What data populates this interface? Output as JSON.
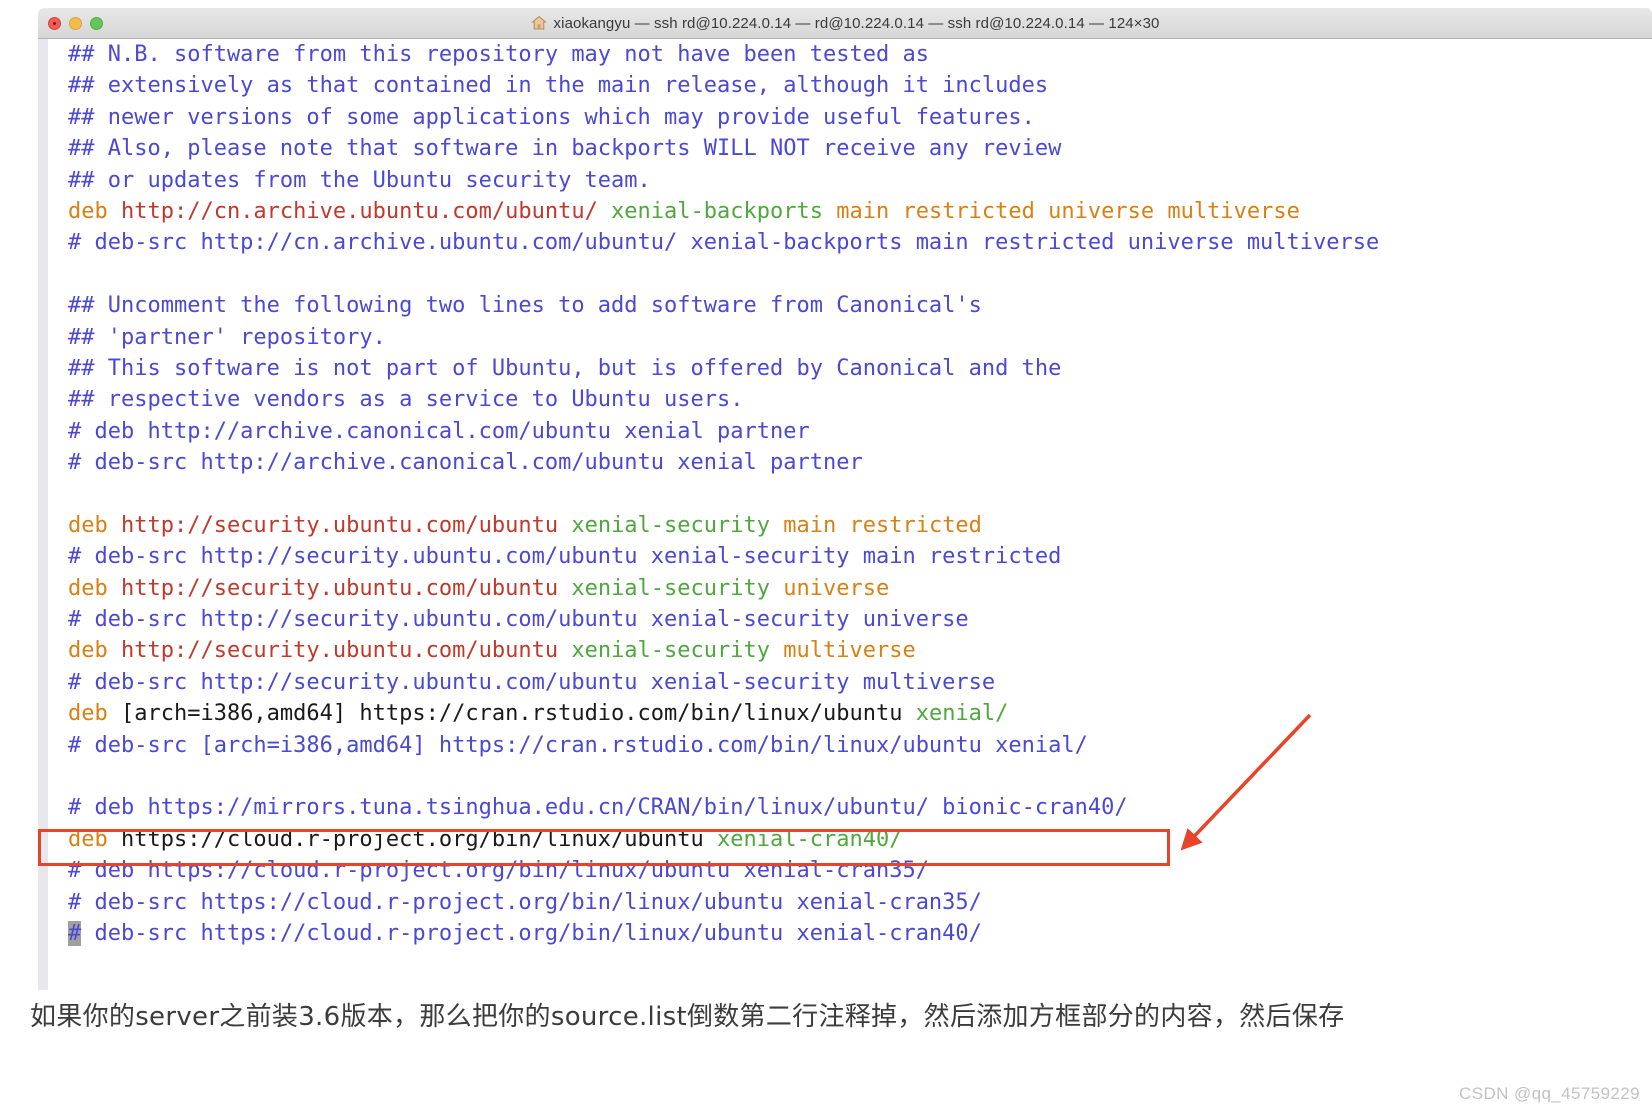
{
  "window": {
    "title": "xiaokangyu — ssh rd@10.224.0.14 — rd@10.224.0.14 — ssh rd@10.224.0.14 — 124×30",
    "home_icon": "home-icon",
    "controls": {
      "close": "close-button",
      "minimize": "minimize-button",
      "zoom": "zoom-button"
    }
  },
  "colors": {
    "comment": "#4b49d4",
    "deb_keyword": "#d98014",
    "url": "#c0392b",
    "distribution": "#4fa83d",
    "components": "#d98014",
    "plain": "#1a1a1a",
    "annotation": "#e8442a",
    "cursor": "#a0a0a0"
  },
  "terminal": {
    "lines": [
      {
        "id": 1,
        "segments": [
          {
            "text": "## N.B. software from this repository may not have been tested as",
            "style": "comment"
          }
        ]
      },
      {
        "id": 2,
        "segments": [
          {
            "text": "## extensively as that contained in the main release, although it includes",
            "style": "comment"
          }
        ]
      },
      {
        "id": 3,
        "segments": [
          {
            "text": "## newer versions of some applications which may provide useful features.",
            "style": "comment"
          }
        ]
      },
      {
        "id": 4,
        "segments": [
          {
            "text": "## Also, please note that software in backports WILL NOT receive any review",
            "style": "comment"
          }
        ]
      },
      {
        "id": 5,
        "segments": [
          {
            "text": "## or updates from the Ubuntu security team.",
            "style": "comment"
          }
        ]
      },
      {
        "id": 6,
        "segments": [
          {
            "text": "deb ",
            "style": "deb"
          },
          {
            "text": "http://cn.archive.ubuntu.com/ubuntu/ ",
            "style": "url"
          },
          {
            "text": "xenial-backports ",
            "style": "dist"
          },
          {
            "text": "main restricted universe multiverse",
            "style": "comp"
          }
        ]
      },
      {
        "id": 7,
        "segments": [
          {
            "text": "# deb-src http://cn.archive.ubuntu.com/ubuntu/ xenial-backports main restricted universe multiverse",
            "style": "comment"
          }
        ]
      },
      {
        "id": 8,
        "segments": [
          {
            "text": "",
            "style": "plain"
          }
        ]
      },
      {
        "id": 9,
        "segments": [
          {
            "text": "## Uncomment the following two lines to add software from Canonical's",
            "style": "comment"
          }
        ]
      },
      {
        "id": 10,
        "segments": [
          {
            "text": "## 'partner' repository.",
            "style": "comment"
          }
        ]
      },
      {
        "id": 11,
        "segments": [
          {
            "text": "## This software is not part of Ubuntu, but is offered by Canonical and the",
            "style": "comment"
          }
        ]
      },
      {
        "id": 12,
        "segments": [
          {
            "text": "## respective vendors as a service to Ubuntu users.",
            "style": "comment"
          }
        ]
      },
      {
        "id": 13,
        "segments": [
          {
            "text": "# deb http://archive.canonical.com/ubuntu xenial partner",
            "style": "comment"
          }
        ]
      },
      {
        "id": 14,
        "segments": [
          {
            "text": "# deb-src http://archive.canonical.com/ubuntu xenial partner",
            "style": "comment"
          }
        ]
      },
      {
        "id": 15,
        "segments": [
          {
            "text": "",
            "style": "plain"
          }
        ]
      },
      {
        "id": 16,
        "segments": [
          {
            "text": "deb ",
            "style": "deb"
          },
          {
            "text": "http://security.ubuntu.com/ubuntu ",
            "style": "url"
          },
          {
            "text": "xenial-security ",
            "style": "dist"
          },
          {
            "text": "main restricted",
            "style": "comp"
          }
        ]
      },
      {
        "id": 17,
        "segments": [
          {
            "text": "# deb-src http://security.ubuntu.com/ubuntu xenial-security main restricted",
            "style": "comment"
          }
        ]
      },
      {
        "id": 18,
        "segments": [
          {
            "text": "deb ",
            "style": "deb"
          },
          {
            "text": "http://security.ubuntu.com/ubuntu ",
            "style": "url"
          },
          {
            "text": "xenial-security ",
            "style": "dist"
          },
          {
            "text": "universe",
            "style": "comp"
          }
        ]
      },
      {
        "id": 19,
        "segments": [
          {
            "text": "# deb-src http://security.ubuntu.com/ubuntu xenial-security universe",
            "style": "comment"
          }
        ]
      },
      {
        "id": 20,
        "segments": [
          {
            "text": "deb ",
            "style": "deb"
          },
          {
            "text": "http://security.ubuntu.com/ubuntu ",
            "style": "url"
          },
          {
            "text": "xenial-security ",
            "style": "dist"
          },
          {
            "text": "multiverse",
            "style": "comp"
          }
        ]
      },
      {
        "id": 21,
        "segments": [
          {
            "text": "# deb-src http://security.ubuntu.com/ubuntu xenial-security multiverse",
            "style": "comment"
          }
        ]
      },
      {
        "id": 22,
        "segments": [
          {
            "text": "deb ",
            "style": "deb"
          },
          {
            "text": "[arch=i386,amd64] https://cran.rstudio.com/bin/linux/ubuntu ",
            "style": "plain"
          },
          {
            "text": "xenial/",
            "style": "dist"
          }
        ]
      },
      {
        "id": 23,
        "segments": [
          {
            "text": "# deb-src [arch=i386,amd64] https://cran.rstudio.com/bin/linux/ubuntu xenial/",
            "style": "comment"
          }
        ]
      },
      {
        "id": 24,
        "segments": [
          {
            "text": "",
            "style": "plain"
          }
        ]
      },
      {
        "id": 25,
        "segments": [
          {
            "text": "# deb https://mirrors.tuna.tsinghua.edu.cn/CRAN/bin/linux/ubuntu/ bionic-cran40/",
            "style": "comment"
          }
        ]
      },
      {
        "id": 26,
        "segments": [
          {
            "text": "deb ",
            "style": "deb"
          },
          {
            "text": "https://cloud.r-project.org/bin/linux/ubuntu ",
            "style": "plain"
          },
          {
            "text": "xenial-cran40/",
            "style": "dist"
          }
        ]
      },
      {
        "id": 27,
        "segments": [
          {
            "text": "# deb https://cloud.r-project.org/bin/linux/ubuntu xenial-cran35/",
            "style": "comment"
          }
        ]
      },
      {
        "id": 28,
        "segments": [
          {
            "text": "# deb-src https://cloud.r-project.org/bin/linux/ubuntu xenial-cran35/",
            "style": "comment"
          }
        ]
      },
      {
        "id": 29,
        "segments": [
          {
            "text": "#",
            "style": "cursor"
          },
          {
            "text": " deb-src https://cloud.r-project.org/bin/linux/ubuntu xenial-cran40/",
            "style": "comment"
          }
        ]
      }
    ]
  },
  "annotations": {
    "highlight_box_target_line": 26,
    "arrow_label": "red-arrow-pointing-to-highlighted-line"
  },
  "caption": {
    "text": "如果你的server之前装3.6版本，那么把你的source.list倒数第二行注释掉，然后添加方框部分的内容，然后保存",
    "watermark": "CSDN @qq_45759229"
  }
}
